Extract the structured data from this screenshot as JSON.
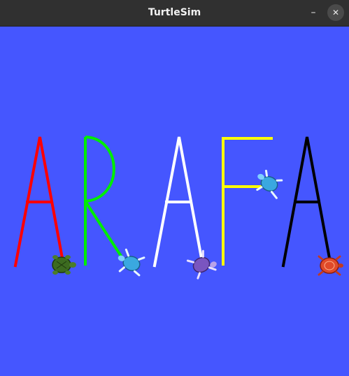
{
  "window": {
    "title": "TurtleSim",
    "minimize_glyph": "–",
    "close_glyph": "✕"
  },
  "canvas": {
    "background": "#4556ff"
  },
  "letters": [
    {
      "char": "A",
      "color": "#ff0000"
    },
    {
      "char": "R",
      "color": "#00ee00"
    },
    {
      "char": "A",
      "color": "#ffffff"
    },
    {
      "char": "F",
      "color": "#ffff00"
    },
    {
      "char": "A",
      "color": "#000000"
    }
  ],
  "turtles": [
    {
      "icon": "turtle-green-icon",
      "color": "#3c6b20"
    },
    {
      "icon": "turtle-blue-icon",
      "color": "#3aa8e0"
    },
    {
      "icon": "turtle-purple-icon",
      "color": "#7a55c0"
    },
    {
      "icon": "turtle-blue-icon",
      "color": "#3aa8e0"
    },
    {
      "icon": "turtle-red-icon",
      "color": "#e04a2a"
    }
  ]
}
